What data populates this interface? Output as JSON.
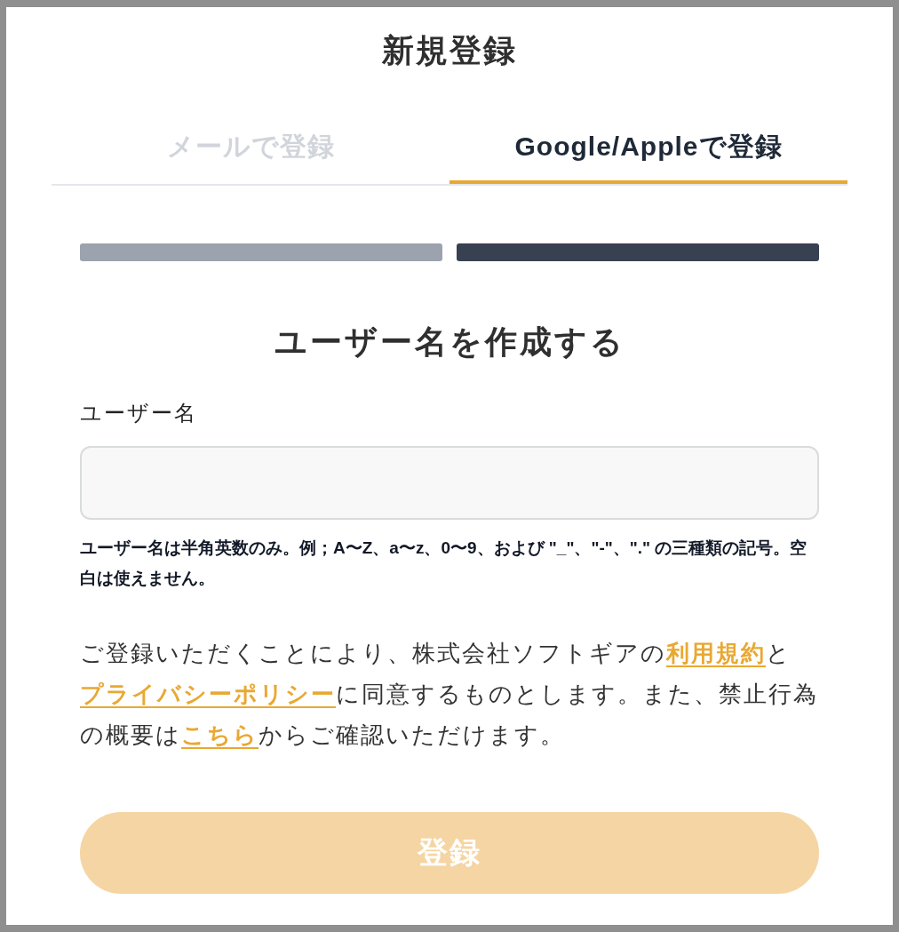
{
  "title": "新規登録",
  "tabs": [
    {
      "label": "メールで登録",
      "selected": false
    },
    {
      "label": "Google/Appleで登録",
      "selected": true
    }
  ],
  "steps": [
    {
      "active": false
    },
    {
      "active": true
    }
  ],
  "heading": "ユーザー名を作成する",
  "username_field": {
    "label": "ユーザー名",
    "hint": "ユーザー名は半角英数のみ。例；A〜Z、a〜z、0〜9、および \"_\"、\"-\"、\".\" の三種類の記号。空白は使えません。"
  },
  "terms": [
    {
      "kind": "text",
      "text": "ご登録いただくことにより、株式会社ソフトギアの"
    },
    {
      "kind": "link",
      "text": "利用規約"
    },
    {
      "kind": "text",
      "text": "と"
    },
    {
      "kind": "link",
      "text": "プライバシーポリシー"
    },
    {
      "kind": "text",
      "text": "に同意するものとします。また、禁止行為の概要は"
    },
    {
      "kind": "link",
      "text": "こちら"
    },
    {
      "kind": "text",
      "text": "からご確認いただけます。"
    }
  ],
  "submit_button": {
    "label": "登録",
    "disabled": true
  }
}
